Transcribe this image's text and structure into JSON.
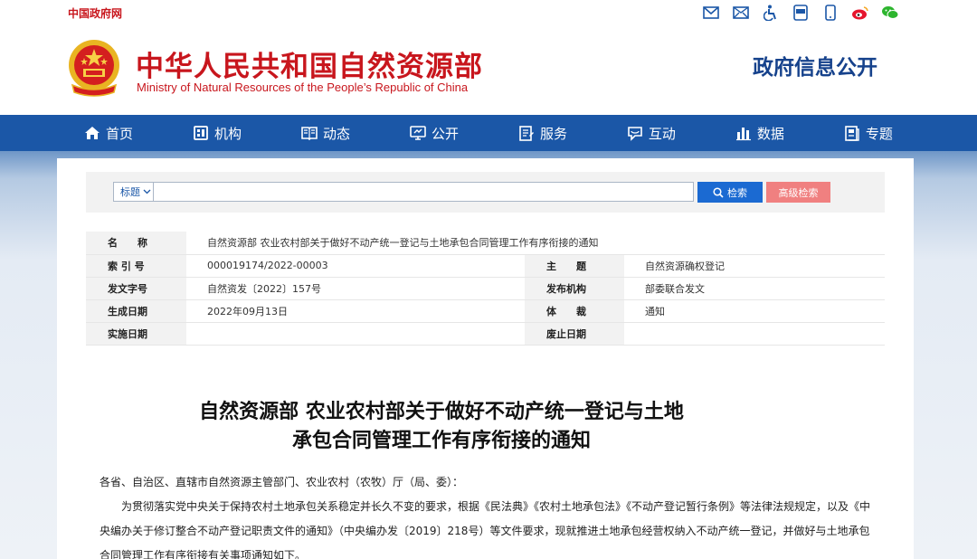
{
  "topbar": {
    "gov_link": "中国政府网",
    "icons": [
      "mail-icon",
      "email-icon",
      "accessibility-icon",
      "app-icon",
      "mobile-icon",
      "weibo-icon",
      "wechat-icon"
    ]
  },
  "header": {
    "title_cn": "中华人民共和国自然资源部",
    "title_en": "Ministry of Natural Resources of the People’s Republic of China",
    "right_title": "政府信息公开"
  },
  "nav": {
    "items": [
      {
        "label": "首页",
        "icon": "home-icon"
      },
      {
        "label": "机构",
        "icon": "organization-icon"
      },
      {
        "label": "动态",
        "icon": "news-icon"
      },
      {
        "label": "公开",
        "icon": "disclosure-icon"
      },
      {
        "label": "服务",
        "icon": "service-icon"
      },
      {
        "label": "互动",
        "icon": "interaction-icon"
      },
      {
        "label": "数据",
        "icon": "data-icon"
      },
      {
        "label": "专题",
        "icon": "topic-icon"
      }
    ]
  },
  "search": {
    "select_value": "标题",
    "placeholder": "",
    "search_label": "检索",
    "advanced_label": "高级检索"
  },
  "info": {
    "name_label": "名　　称",
    "name_value": "自然资源部 农业农村部关于做好不动产统一登记与土地承包合同管理工作有序衔接的通知",
    "index_label": "索 引 号",
    "index_value": "000019174/2022-00003",
    "subject_label": "主　　题",
    "subject_value": "自然资源确权登记",
    "docno_label": "发文字号",
    "docno_value": "自然资发〔2022〕157号",
    "issuer_label": "发布机构",
    "issuer_value": "部委联合发文",
    "date_label": "生成日期",
    "date_value": "2022年09月13日",
    "genre_label": "体　　裁",
    "genre_value": "通知",
    "effective_label": "实施日期",
    "effective_value": "",
    "expiry_label": "废止日期",
    "expiry_value": ""
  },
  "article": {
    "title_line1": "自然资源部 农业农村部关于做好不动产统一登记与土地",
    "title_line2": "承包合同管理工作有序衔接的通知",
    "salutation": "各省、自治区、直辖市自然资源主管部门、农业农村（农牧）厅（局、委）：",
    "para1": "为贯彻落实党中央关于保持农村土地承包关系稳定并长久不变的要求，根据《民法典》《农村土地承包法》《不动产登记暂行条例》等法律法规规定，以及《中央编办关于修订整合不动产登记职责文件的通知》（中央编办发〔2019〕218号）等文件要求，现就推进土地承包经营权纳入不动产统一登记，并做好与土地承包合同管理工作有序衔接有关事项通知如下。"
  },
  "colors": {
    "brand_red": "#c8161d",
    "nav_blue": "#1b57a7",
    "search_blue": "#1b6ad2",
    "advanced_pink": "#f08080"
  }
}
